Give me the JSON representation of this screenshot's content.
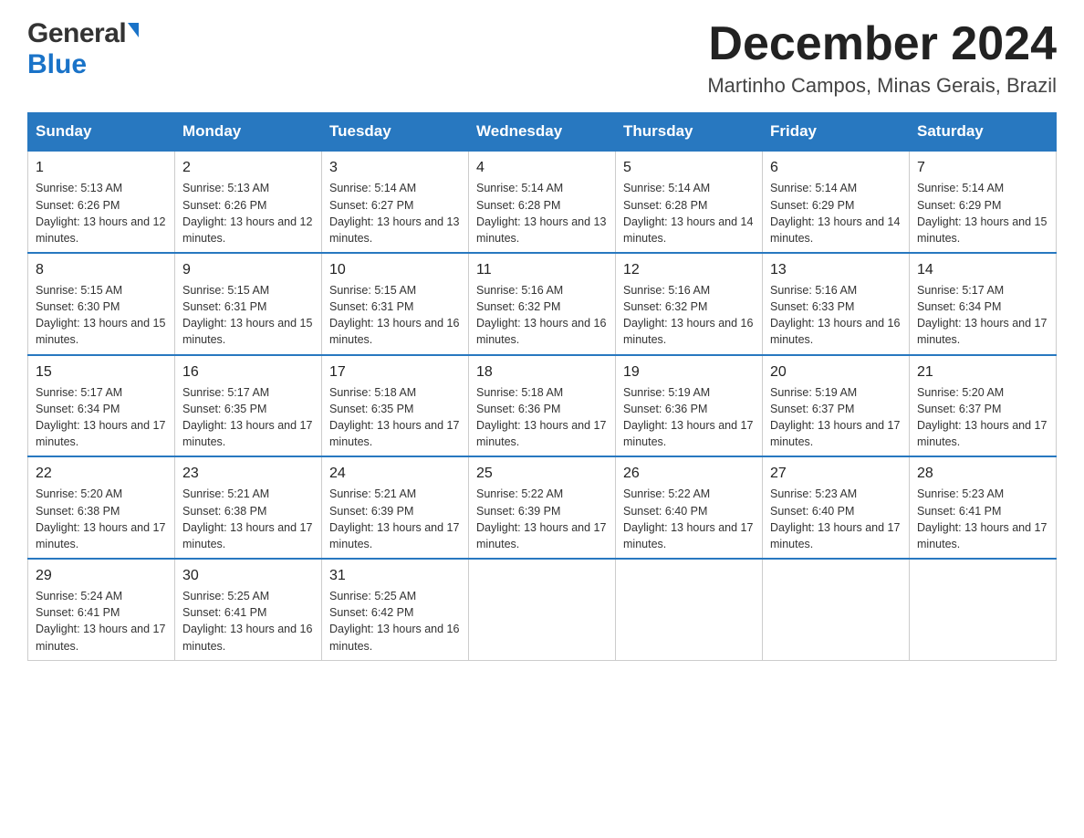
{
  "header": {
    "logo_general": "General",
    "logo_blue": "Blue",
    "month_title": "December 2024",
    "location": "Martinho Campos, Minas Gerais, Brazil"
  },
  "days_of_week": [
    "Sunday",
    "Monday",
    "Tuesday",
    "Wednesday",
    "Thursday",
    "Friday",
    "Saturday"
  ],
  "weeks": [
    [
      {
        "day": "1",
        "sunrise": "5:13 AM",
        "sunset": "6:26 PM",
        "daylight": "13 hours and 12 minutes."
      },
      {
        "day": "2",
        "sunrise": "5:13 AM",
        "sunset": "6:26 PM",
        "daylight": "13 hours and 12 minutes."
      },
      {
        "day": "3",
        "sunrise": "5:14 AM",
        "sunset": "6:27 PM",
        "daylight": "13 hours and 13 minutes."
      },
      {
        "day": "4",
        "sunrise": "5:14 AM",
        "sunset": "6:28 PM",
        "daylight": "13 hours and 13 minutes."
      },
      {
        "day": "5",
        "sunrise": "5:14 AM",
        "sunset": "6:28 PM",
        "daylight": "13 hours and 14 minutes."
      },
      {
        "day": "6",
        "sunrise": "5:14 AM",
        "sunset": "6:29 PM",
        "daylight": "13 hours and 14 minutes."
      },
      {
        "day": "7",
        "sunrise": "5:14 AM",
        "sunset": "6:29 PM",
        "daylight": "13 hours and 15 minutes."
      }
    ],
    [
      {
        "day": "8",
        "sunrise": "5:15 AM",
        "sunset": "6:30 PM",
        "daylight": "13 hours and 15 minutes."
      },
      {
        "day": "9",
        "sunrise": "5:15 AM",
        "sunset": "6:31 PM",
        "daylight": "13 hours and 15 minutes."
      },
      {
        "day": "10",
        "sunrise": "5:15 AM",
        "sunset": "6:31 PM",
        "daylight": "13 hours and 16 minutes."
      },
      {
        "day": "11",
        "sunrise": "5:16 AM",
        "sunset": "6:32 PM",
        "daylight": "13 hours and 16 minutes."
      },
      {
        "day": "12",
        "sunrise": "5:16 AM",
        "sunset": "6:32 PM",
        "daylight": "13 hours and 16 minutes."
      },
      {
        "day": "13",
        "sunrise": "5:16 AM",
        "sunset": "6:33 PM",
        "daylight": "13 hours and 16 minutes."
      },
      {
        "day": "14",
        "sunrise": "5:17 AM",
        "sunset": "6:34 PM",
        "daylight": "13 hours and 17 minutes."
      }
    ],
    [
      {
        "day": "15",
        "sunrise": "5:17 AM",
        "sunset": "6:34 PM",
        "daylight": "13 hours and 17 minutes."
      },
      {
        "day": "16",
        "sunrise": "5:17 AM",
        "sunset": "6:35 PM",
        "daylight": "13 hours and 17 minutes."
      },
      {
        "day": "17",
        "sunrise": "5:18 AM",
        "sunset": "6:35 PM",
        "daylight": "13 hours and 17 minutes."
      },
      {
        "day": "18",
        "sunrise": "5:18 AM",
        "sunset": "6:36 PM",
        "daylight": "13 hours and 17 minutes."
      },
      {
        "day": "19",
        "sunrise": "5:19 AM",
        "sunset": "6:36 PM",
        "daylight": "13 hours and 17 minutes."
      },
      {
        "day": "20",
        "sunrise": "5:19 AM",
        "sunset": "6:37 PM",
        "daylight": "13 hours and 17 minutes."
      },
      {
        "day": "21",
        "sunrise": "5:20 AM",
        "sunset": "6:37 PM",
        "daylight": "13 hours and 17 minutes."
      }
    ],
    [
      {
        "day": "22",
        "sunrise": "5:20 AM",
        "sunset": "6:38 PM",
        "daylight": "13 hours and 17 minutes."
      },
      {
        "day": "23",
        "sunrise": "5:21 AM",
        "sunset": "6:38 PM",
        "daylight": "13 hours and 17 minutes."
      },
      {
        "day": "24",
        "sunrise": "5:21 AM",
        "sunset": "6:39 PM",
        "daylight": "13 hours and 17 minutes."
      },
      {
        "day": "25",
        "sunrise": "5:22 AM",
        "sunset": "6:39 PM",
        "daylight": "13 hours and 17 minutes."
      },
      {
        "day": "26",
        "sunrise": "5:22 AM",
        "sunset": "6:40 PM",
        "daylight": "13 hours and 17 minutes."
      },
      {
        "day": "27",
        "sunrise": "5:23 AM",
        "sunset": "6:40 PM",
        "daylight": "13 hours and 17 minutes."
      },
      {
        "day": "28",
        "sunrise": "5:23 AM",
        "sunset": "6:41 PM",
        "daylight": "13 hours and 17 minutes."
      }
    ],
    [
      {
        "day": "29",
        "sunrise": "5:24 AM",
        "sunset": "6:41 PM",
        "daylight": "13 hours and 17 minutes."
      },
      {
        "day": "30",
        "sunrise": "5:25 AM",
        "sunset": "6:41 PM",
        "daylight": "13 hours and 16 minutes."
      },
      {
        "day": "31",
        "sunrise": "5:25 AM",
        "sunset": "6:42 PM",
        "daylight": "13 hours and 16 minutes."
      },
      null,
      null,
      null,
      null
    ]
  ]
}
